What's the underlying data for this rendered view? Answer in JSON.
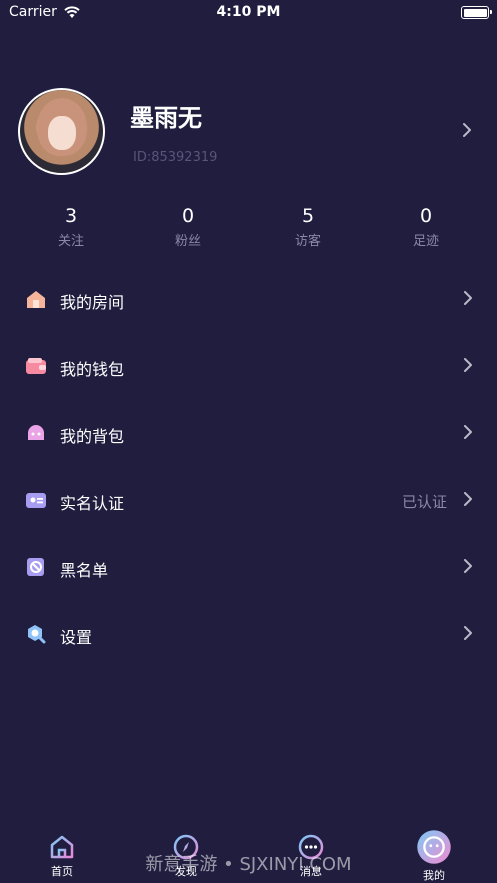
{
  "status_bar": {
    "carrier": "Carrier",
    "time": "4:10 PM"
  },
  "profile": {
    "name": "墨雨无",
    "id_text": "ID:85392319"
  },
  "stats": [
    {
      "value": "3",
      "label": "关注"
    },
    {
      "value": "0",
      "label": "粉丝"
    },
    {
      "value": "5",
      "label": "访客"
    },
    {
      "value": "0",
      "label": "足迹"
    }
  ],
  "menu": [
    {
      "label": "我的房间",
      "icon": "house-icon"
    },
    {
      "label": "我的钱包",
      "icon": "wallet-icon"
    },
    {
      "label": "我的背包",
      "icon": "backpack-icon"
    },
    {
      "label": "实名认证",
      "value": "已认证",
      "icon": "id-card-icon"
    },
    {
      "label": "黑名单",
      "icon": "block-icon"
    },
    {
      "label": "设置",
      "icon": "search-settings-icon"
    }
  ],
  "tabbar": [
    {
      "label": "首页",
      "icon": "home-icon"
    },
    {
      "label": "发现",
      "icon": "compass-icon"
    },
    {
      "label": "消息",
      "icon": "message-icon"
    },
    {
      "label": "我的",
      "icon": "profile-face-icon",
      "active": true
    }
  ],
  "watermark": "新意手游 • SJXINYI.COM",
  "colors": {
    "background": "#201d3f",
    "secondary_text": "#8a88a6",
    "id_text": "#58557a",
    "chevron": "#b9b8c8"
  }
}
